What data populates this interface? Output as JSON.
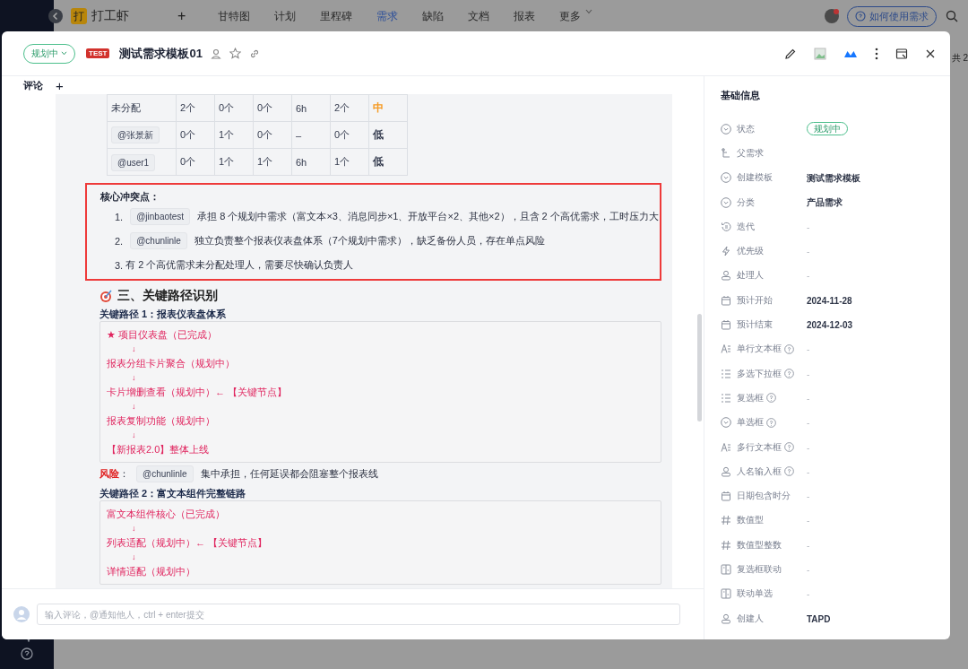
{
  "app_nav": {
    "logo": "打",
    "name": "打工虾",
    "add": "+",
    "items": [
      {
        "label": "甘特图",
        "selected": false
      },
      {
        "label": "计划",
        "selected": false
      },
      {
        "label": "里程碑",
        "selected": false
      },
      {
        "label": "需求",
        "selected": true
      },
      {
        "label": "缺陷",
        "selected": false
      },
      {
        "label": "文档",
        "selected": false
      },
      {
        "label": "报表",
        "selected": false
      },
      {
        "label": "更多",
        "selected": false
      }
    ],
    "help_button": "如何使用需求",
    "side_text": "共 2"
  },
  "dialog": {
    "status": "规划中",
    "tag": "TEST",
    "title": "测试需求模板01",
    "comment_tab": "评论",
    "comment_add": "+",
    "table": {
      "rows": [
        {
          "owner": "未分配",
          "kind": "plain",
          "values": [
            "2个",
            "0个",
            "0个",
            "6h",
            "2个"
          ],
          "load": "中",
          "color": "#f59a23"
        },
        {
          "owner": "@张景新",
          "kind": "mention",
          "values": [
            "0个",
            "1个",
            "0个",
            "–",
            "0个"
          ],
          "load": "低",
          "color": "#333a4d"
        },
        {
          "owner": "@user1",
          "kind": "mention",
          "values": [
            "0个",
            "1个",
            "1个",
            "6h",
            "1个"
          ],
          "load": "低",
          "color": "#333a4d"
        }
      ]
    },
    "conflicts": {
      "title": "核心冲突点：",
      "items": [
        {
          "number": "1.",
          "mention": "@jinbaotest",
          "text": "承担 8 个规划中需求（富文本×3、消息同步×1、开放平台×2、其他×2），且含 2 个高优需求，工时压力大"
        },
        {
          "number": "2.",
          "mention": "@chunlinle",
          "text": "独立负责整个报表仪表盘体系（7个规划中需求），缺乏备份人员，存在单点风险"
        },
        {
          "number": "3.",
          "text": "有 2 个高优需求未分配处理人，需要尽快确认负责人"
        }
      ]
    },
    "section_title": "三、关键路径识别",
    "paths": [
      {
        "title": "关键路径 1：报表仪表盘体系",
        "lines": [
          {
            "kind": "step",
            "text": "★ 项目仪表盘（已完成）"
          },
          {
            "kind": "arrow",
            "text": "↓"
          },
          {
            "kind": "step",
            "text": "报表分组卡片聚合（规划中）"
          },
          {
            "kind": "arrow",
            "text": "↓"
          },
          {
            "kind": "step",
            "text": "卡片增删查看（规划中）←  【关键节点】"
          },
          {
            "kind": "arrow",
            "text": "↓"
          },
          {
            "kind": "step",
            "text": "报表复制功能（规划中）"
          },
          {
            "kind": "arrow",
            "text": "↓"
          },
          {
            "kind": "step",
            "text": "【新报表2.0】整体上线"
          }
        ],
        "risk": {
          "label": "风险",
          "separator": "：",
          "mention": "@chunlinle",
          "text": "集中承担，任何延误都会阻塞整个报表线"
        }
      },
      {
        "title": "关键路径 2：富文本组件完整链路",
        "lines": [
          {
            "kind": "step",
            "text": "富文本组件核心（已完成）"
          },
          {
            "kind": "arrow",
            "text": "↓"
          },
          {
            "kind": "step",
            "text": "列表适配（规划中）←  【关键节点】"
          },
          {
            "kind": "arrow",
            "text": "↓"
          },
          {
            "kind": "step",
            "text": "详情适配（规划中）"
          }
        ]
      }
    ],
    "comment_placeholder": "输入评论，@通知他人，ctrl + enter提交",
    "info": {
      "title": "基础信息",
      "fields": [
        {
          "label": "状态",
          "kind": "status",
          "value": "规划中",
          "help": false
        },
        {
          "label": "父需求",
          "kind": "none",
          "help": false
        },
        {
          "label": "创建模板",
          "kind": "text",
          "value": "测试需求模板",
          "help": false
        },
        {
          "label": "分类",
          "kind": "text",
          "value": "产品需求",
          "help": false
        },
        {
          "label": "迭代",
          "kind": "empty",
          "value": "-",
          "help": false
        },
        {
          "label": "优先级",
          "kind": "empty",
          "value": "-",
          "help": false
        },
        {
          "label": "处理人",
          "kind": "empty",
          "value": "-",
          "help": false
        },
        {
          "label": "预计开始",
          "kind": "text",
          "value": "2024-11-28",
          "help": false
        },
        {
          "label": "预计结束",
          "kind": "text",
          "value": "2024-12-03",
          "help": false
        },
        {
          "label": "单行文本框",
          "kind": "empty",
          "value": "-",
          "help": true
        },
        {
          "label": "多选下拉框",
          "kind": "empty",
          "value": "-",
          "help": true
        },
        {
          "label": "复选框",
          "kind": "empty",
          "value": "-",
          "help": true
        },
        {
          "label": "单选框",
          "kind": "empty",
          "value": "-",
          "help": true
        },
        {
          "label": "多行文本框",
          "kind": "empty",
          "value": "-",
          "help": true
        },
        {
          "label": "人名输入框",
          "kind": "empty",
          "value": "-",
          "help": true
        },
        {
          "label": "日期包含时分",
          "kind": "empty",
          "value": "-",
          "help": false
        },
        {
          "label": "数值型",
          "kind": "empty",
          "value": "-",
          "help": false
        },
        {
          "label": "数值型整数",
          "kind": "empty",
          "value": "-",
          "help": false
        },
        {
          "label": "复选框联动",
          "kind": "empty",
          "value": "-",
          "help": false
        },
        {
          "label": "联动单选",
          "kind": "empty",
          "value": "-",
          "help": false
        },
        {
          "label": "创建人",
          "kind": "text",
          "value": "TAPD",
          "help": false
        }
      ]
    }
  }
}
